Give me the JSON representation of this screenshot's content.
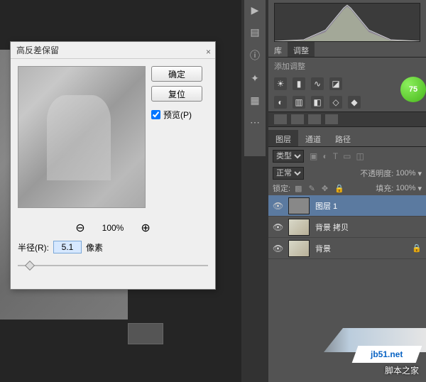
{
  "dialog": {
    "title": "高反差保留",
    "ok": "确定",
    "reset": "复位",
    "preview_label": "预览(P)",
    "preview_checked": true,
    "zoom": "100%",
    "radius_label": "半径(R):",
    "radius_value": "5.1",
    "radius_unit": "像素"
  },
  "panels": {
    "lib": "库",
    "adjust": "调整",
    "add_adjust": "添加调整",
    "badge": "75"
  },
  "layers": {
    "tab_layers": "图层",
    "tab_channels": "通道",
    "tab_paths": "路径",
    "kind": "类型",
    "blend": "正常",
    "opacity_label": "不透明度:",
    "opacity": "100%",
    "lock_label": "锁定:",
    "fill_label": "填充:",
    "fill": "100%",
    "items": [
      {
        "name": "图层 1",
        "selected": true,
        "locked": false,
        "gray": true
      },
      {
        "name": "背景 拷贝",
        "selected": false,
        "locked": false,
        "gray": false
      },
      {
        "name": "背景",
        "selected": false,
        "locked": true,
        "gray": false
      }
    ]
  },
  "watermark": {
    "site": "jb51.net",
    "text": "脚本之家"
  }
}
